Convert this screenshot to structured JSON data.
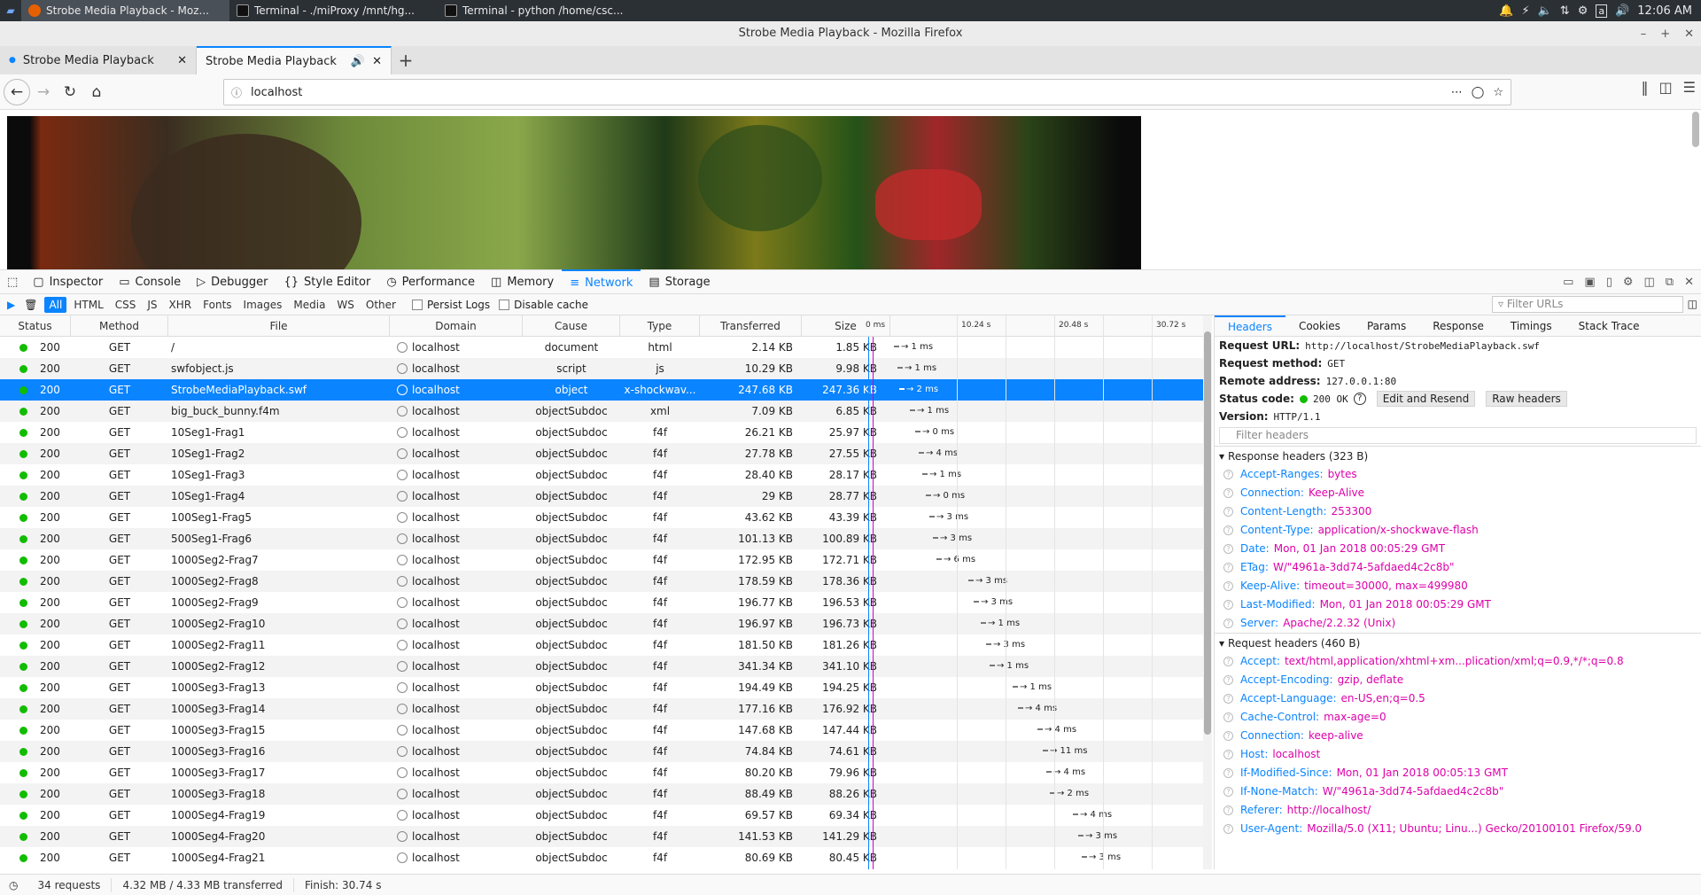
{
  "taskbar": {
    "apps": [
      {
        "label": "Strobe Media Playback - Moz...",
        "active": true
      },
      {
        "label": "Terminal - ./miProxy  /mnt/hg...",
        "active": false
      },
      {
        "label": "Terminal - python  /home/csc...",
        "active": false
      }
    ],
    "clock": "12:06 AM"
  },
  "window": {
    "title": "Strobe Media Playback - Mozilla Firefox"
  },
  "tabs": [
    {
      "label": "Strobe Media Playback"
    },
    {
      "label": "Strobe Media Playback"
    }
  ],
  "urlbar": {
    "url": "localhost"
  },
  "devtools": {
    "tabs": [
      "Inspector",
      "Console",
      "Debugger",
      "Style Editor",
      "Performance",
      "Memory",
      "Network",
      "Storage"
    ],
    "selected": "Network"
  },
  "filters": {
    "buttons": [
      "All",
      "HTML",
      "CSS",
      "JS",
      "XHR",
      "Fonts",
      "Images",
      "Media",
      "WS",
      "Other"
    ],
    "persist_logs": "Persist Logs",
    "disable_cache": "Disable cache",
    "filter_urls_placeholder": "Filter URLs"
  },
  "table": {
    "columns": [
      "Status",
      "Method",
      "File",
      "Domain",
      "Cause",
      "Type",
      "Transferred",
      "Size"
    ],
    "waterfall_ticks": [
      "0 ms",
      "10.24 s",
      "20.48 s",
      "30.72 s"
    ],
    "rows": [
      {
        "status": "200",
        "method": "GET",
        "file": "/",
        "domain": "localhost",
        "cause": "document",
        "type": "html",
        "transferred": "2.14 KB",
        "size": "1.85 KB",
        "timing": "→ 1 ms",
        "offset": 0
      },
      {
        "status": "200",
        "method": "GET",
        "file": "swfobject.js",
        "domain": "localhost",
        "cause": "script",
        "type": "js",
        "transferred": "10.29 KB",
        "size": "9.98 KB",
        "timing": "→ 1 ms",
        "offset": 4
      },
      {
        "status": "200",
        "method": "GET",
        "file": "StrobeMediaPlayback.swf",
        "domain": "localhost",
        "cause": "object",
        "type": "x-shockwav...",
        "transferred": "247.68 KB",
        "size": "247.36 KB",
        "timing": "→ 2 ms",
        "offset": 6,
        "selected": true
      },
      {
        "status": "200",
        "method": "GET",
        "file": "big_buck_bunny.f4m",
        "domain": "localhost",
        "cause": "objectSubdoc",
        "type": "xml",
        "transferred": "7.09 KB",
        "size": "6.85 KB",
        "timing": "→ 1 ms",
        "offset": 18
      },
      {
        "status": "200",
        "method": "GET",
        "file": "10Seg1-Frag1",
        "domain": "localhost",
        "cause": "objectSubdoc",
        "type": "f4f",
        "transferred": "26.21 KB",
        "size": "25.97 KB",
        "timing": "→ 0 ms",
        "offset": 24
      },
      {
        "status": "200",
        "method": "GET",
        "file": "10Seg1-Frag2",
        "domain": "localhost",
        "cause": "objectSubdoc",
        "type": "f4f",
        "transferred": "27.78 KB",
        "size": "27.55 KB",
        "timing": "→ 4 ms",
        "offset": 28
      },
      {
        "status": "200",
        "method": "GET",
        "file": "10Seg1-Frag3",
        "domain": "localhost",
        "cause": "objectSubdoc",
        "type": "f4f",
        "transferred": "28.40 KB",
        "size": "28.17 KB",
        "timing": "→ 1 ms",
        "offset": 32
      },
      {
        "status": "200",
        "method": "GET",
        "file": "10Seg1-Frag4",
        "domain": "localhost",
        "cause": "objectSubdoc",
        "type": "f4f",
        "transferred": "29 KB",
        "size": "28.77 KB",
        "timing": "→ 0 ms",
        "offset": 36
      },
      {
        "status": "200",
        "method": "GET",
        "file": "100Seg1-Frag5",
        "domain": "localhost",
        "cause": "objectSubdoc",
        "type": "f4f",
        "transferred": "43.62 KB",
        "size": "43.39 KB",
        "timing": "→ 3 ms",
        "offset": 40
      },
      {
        "status": "200",
        "method": "GET",
        "file": "500Seg1-Frag6",
        "domain": "localhost",
        "cause": "objectSubdoc",
        "type": "f4f",
        "transferred": "101.13 KB",
        "size": "100.89 KB",
        "timing": "→ 3 ms",
        "offset": 44
      },
      {
        "status": "200",
        "method": "GET",
        "file": "1000Seg2-Frag7",
        "domain": "localhost",
        "cause": "objectSubdoc",
        "type": "f4f",
        "transferred": "172.95 KB",
        "size": "172.71 KB",
        "timing": "→ 6 ms",
        "offset": 48
      },
      {
        "status": "200",
        "method": "GET",
        "file": "1000Seg2-Frag8",
        "domain": "localhost",
        "cause": "objectSubdoc",
        "type": "f4f",
        "transferred": "178.59 KB",
        "size": "178.36 KB",
        "timing": "→ 3 ms",
        "offset": 84
      },
      {
        "status": "200",
        "method": "GET",
        "file": "1000Seg2-Frag9",
        "domain": "localhost",
        "cause": "objectSubdoc",
        "type": "f4f",
        "transferred": "196.77 KB",
        "size": "196.53 KB",
        "timing": "→ 3 ms",
        "offset": 90
      },
      {
        "status": "200",
        "method": "GET",
        "file": "1000Seg2-Frag10",
        "domain": "localhost",
        "cause": "objectSubdoc",
        "type": "f4f",
        "transferred": "196.97 KB",
        "size": "196.73 KB",
        "timing": "→ 1 ms",
        "offset": 98
      },
      {
        "status": "200",
        "method": "GET",
        "file": "1000Seg2-Frag11",
        "domain": "localhost",
        "cause": "objectSubdoc",
        "type": "f4f",
        "transferred": "181.50 KB",
        "size": "181.26 KB",
        "timing": "→ 3 ms",
        "offset": 104
      },
      {
        "status": "200",
        "method": "GET",
        "file": "1000Seg2-Frag12",
        "domain": "localhost",
        "cause": "objectSubdoc",
        "type": "f4f",
        "transferred": "341.34 KB",
        "size": "341.10 KB",
        "timing": "→ 1 ms",
        "offset": 108
      },
      {
        "status": "200",
        "method": "GET",
        "file": "1000Seg3-Frag13",
        "domain": "localhost",
        "cause": "objectSubdoc",
        "type": "f4f",
        "transferred": "194.49 KB",
        "size": "194.25 KB",
        "timing": "→ 1 ms",
        "offset": 134
      },
      {
        "status": "200",
        "method": "GET",
        "file": "1000Seg3-Frag14",
        "domain": "localhost",
        "cause": "objectSubdoc",
        "type": "f4f",
        "transferred": "177.16 KB",
        "size": "176.92 KB",
        "timing": "→ 4 ms",
        "offset": 140
      },
      {
        "status": "200",
        "method": "GET",
        "file": "1000Seg3-Frag15",
        "domain": "localhost",
        "cause": "objectSubdoc",
        "type": "f4f",
        "transferred": "147.68 KB",
        "size": "147.44 KB",
        "timing": "→ 4 ms",
        "offset": 162
      },
      {
        "status": "200",
        "method": "GET",
        "file": "1000Seg3-Frag16",
        "domain": "localhost",
        "cause": "objectSubdoc",
        "type": "f4f",
        "transferred": "74.84 KB",
        "size": "74.61 KB",
        "timing": "→ 11 ms",
        "offset": 168
      },
      {
        "status": "200",
        "method": "GET",
        "file": "1000Seg3-Frag17",
        "domain": "localhost",
        "cause": "objectSubdoc",
        "type": "f4f",
        "transferred": "80.20 KB",
        "size": "79.96 KB",
        "timing": "→ 4 ms",
        "offset": 172
      },
      {
        "status": "200",
        "method": "GET",
        "file": "1000Seg3-Frag18",
        "domain": "localhost",
        "cause": "objectSubdoc",
        "type": "f4f",
        "transferred": "88.49 KB",
        "size": "88.26 KB",
        "timing": "→ 2 ms",
        "offset": 176
      },
      {
        "status": "200",
        "method": "GET",
        "file": "1000Seg4-Frag19",
        "domain": "localhost",
        "cause": "objectSubdoc",
        "type": "f4f",
        "transferred": "69.57 KB",
        "size": "69.34 KB",
        "timing": "→ 4 ms",
        "offset": 202
      },
      {
        "status": "200",
        "method": "GET",
        "file": "1000Seg4-Frag20",
        "domain": "localhost",
        "cause": "objectSubdoc",
        "type": "f4f",
        "transferred": "141.53 KB",
        "size": "141.29 KB",
        "timing": "→ 3 ms",
        "offset": 208
      },
      {
        "status": "200",
        "method": "GET",
        "file": "1000Seg4-Frag21",
        "domain": "localhost",
        "cause": "objectSubdoc",
        "type": "f4f",
        "transferred": "80.69 KB",
        "size": "80.45 KB",
        "timing": "→ 3 ms",
        "offset": 212
      }
    ]
  },
  "details": {
    "tabs": [
      "Headers",
      "Cookies",
      "Params",
      "Response",
      "Timings",
      "Stack Trace"
    ],
    "selected": "Headers",
    "request_url_label": "Request URL:",
    "request_url": "http://localhost/StrobeMediaPlayback.swf",
    "method_label": "Request method:",
    "method": "GET",
    "remote_label": "Remote address:",
    "remote": "127.0.0.1:80",
    "status_label": "Status code:",
    "status": "200 OK",
    "edit_resend": "Edit and Resend",
    "raw_headers": "Raw headers",
    "version_label": "Version:",
    "version": "HTTP/1.1",
    "filter_placeholder": "Filter headers",
    "response_title": "Response headers (323 B)",
    "response_headers": [
      {
        "k": "Accept-Ranges:",
        "v": "bytes"
      },
      {
        "k": "Connection:",
        "v": "Keep-Alive"
      },
      {
        "k": "Content-Length:",
        "v": "253300"
      },
      {
        "k": "Content-Type:",
        "v": "application/x-shockwave-flash"
      },
      {
        "k": "Date:",
        "v": "Mon, 01 Jan 2018 00:05:29 GMT"
      },
      {
        "k": "ETag:",
        "v": "W/\"4961a-3dd74-5afdaed4c2c8b\""
      },
      {
        "k": "Keep-Alive:",
        "v": "timeout=30000, max=499980"
      },
      {
        "k": "Last-Modified:",
        "v": "Mon, 01 Jan 2018 00:05:29 GMT"
      },
      {
        "k": "Server:",
        "v": "Apache/2.2.32 (Unix)"
      }
    ],
    "request_title": "Request headers (460 B)",
    "request_headers": [
      {
        "k": "Accept:",
        "v": "text/html,application/xhtml+xm...plication/xml;q=0.9,*/*;q=0.8"
      },
      {
        "k": "Accept-Encoding:",
        "v": "gzip, deflate"
      },
      {
        "k": "Accept-Language:",
        "v": "en-US,en;q=0.5"
      },
      {
        "k": "Cache-Control:",
        "v": "max-age=0"
      },
      {
        "k": "Connection:",
        "v": "keep-alive"
      },
      {
        "k": "Host:",
        "v": "localhost"
      },
      {
        "k": "If-Modified-Since:",
        "v": "Mon, 01 Jan 2018 00:05:13 GMT"
      },
      {
        "k": "If-None-Match:",
        "v": "W/\"4961a-3dd74-5afdaed4c2c8b\""
      },
      {
        "k": "Referer:",
        "v": "http://localhost/"
      },
      {
        "k": "User-Agent:",
        "v": "Mozilla/5.0 (X11; Ubuntu; Linu...) Gecko/20100101 Firefox/59.0"
      }
    ]
  },
  "status": {
    "requests": "34 requests",
    "transferred": "4.32 MB / 4.33 MB transferred",
    "finish": "Finish: 30.74 s"
  },
  "colors": {
    "accent": "#0a84ff",
    "ok": "#12bc00",
    "header_value": "#dd00a9"
  }
}
